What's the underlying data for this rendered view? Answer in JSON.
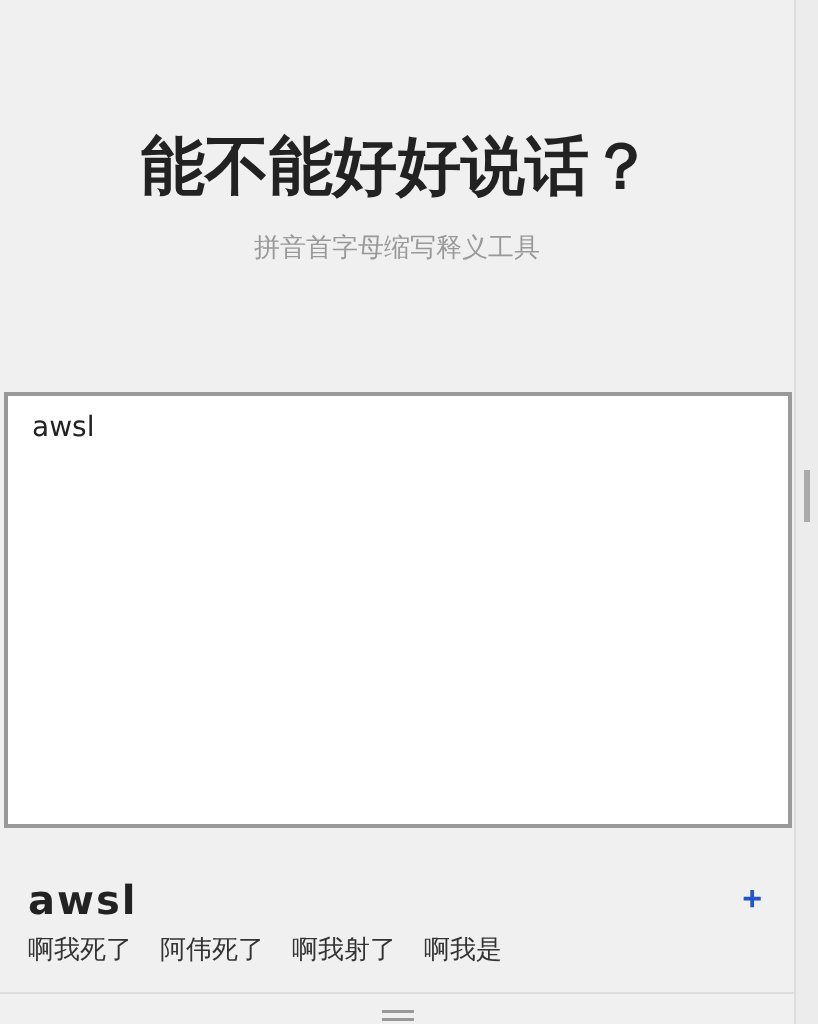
{
  "header": {
    "title": "能不能好好说话？",
    "subtitle": "拼音首字母缩写释义工具"
  },
  "input": {
    "value": "awsl"
  },
  "result": {
    "word": "awsl",
    "add_button": "+",
    "meanings": [
      "啊我死了",
      "阿伟死了",
      "啊我射了",
      "啊我是"
    ]
  }
}
